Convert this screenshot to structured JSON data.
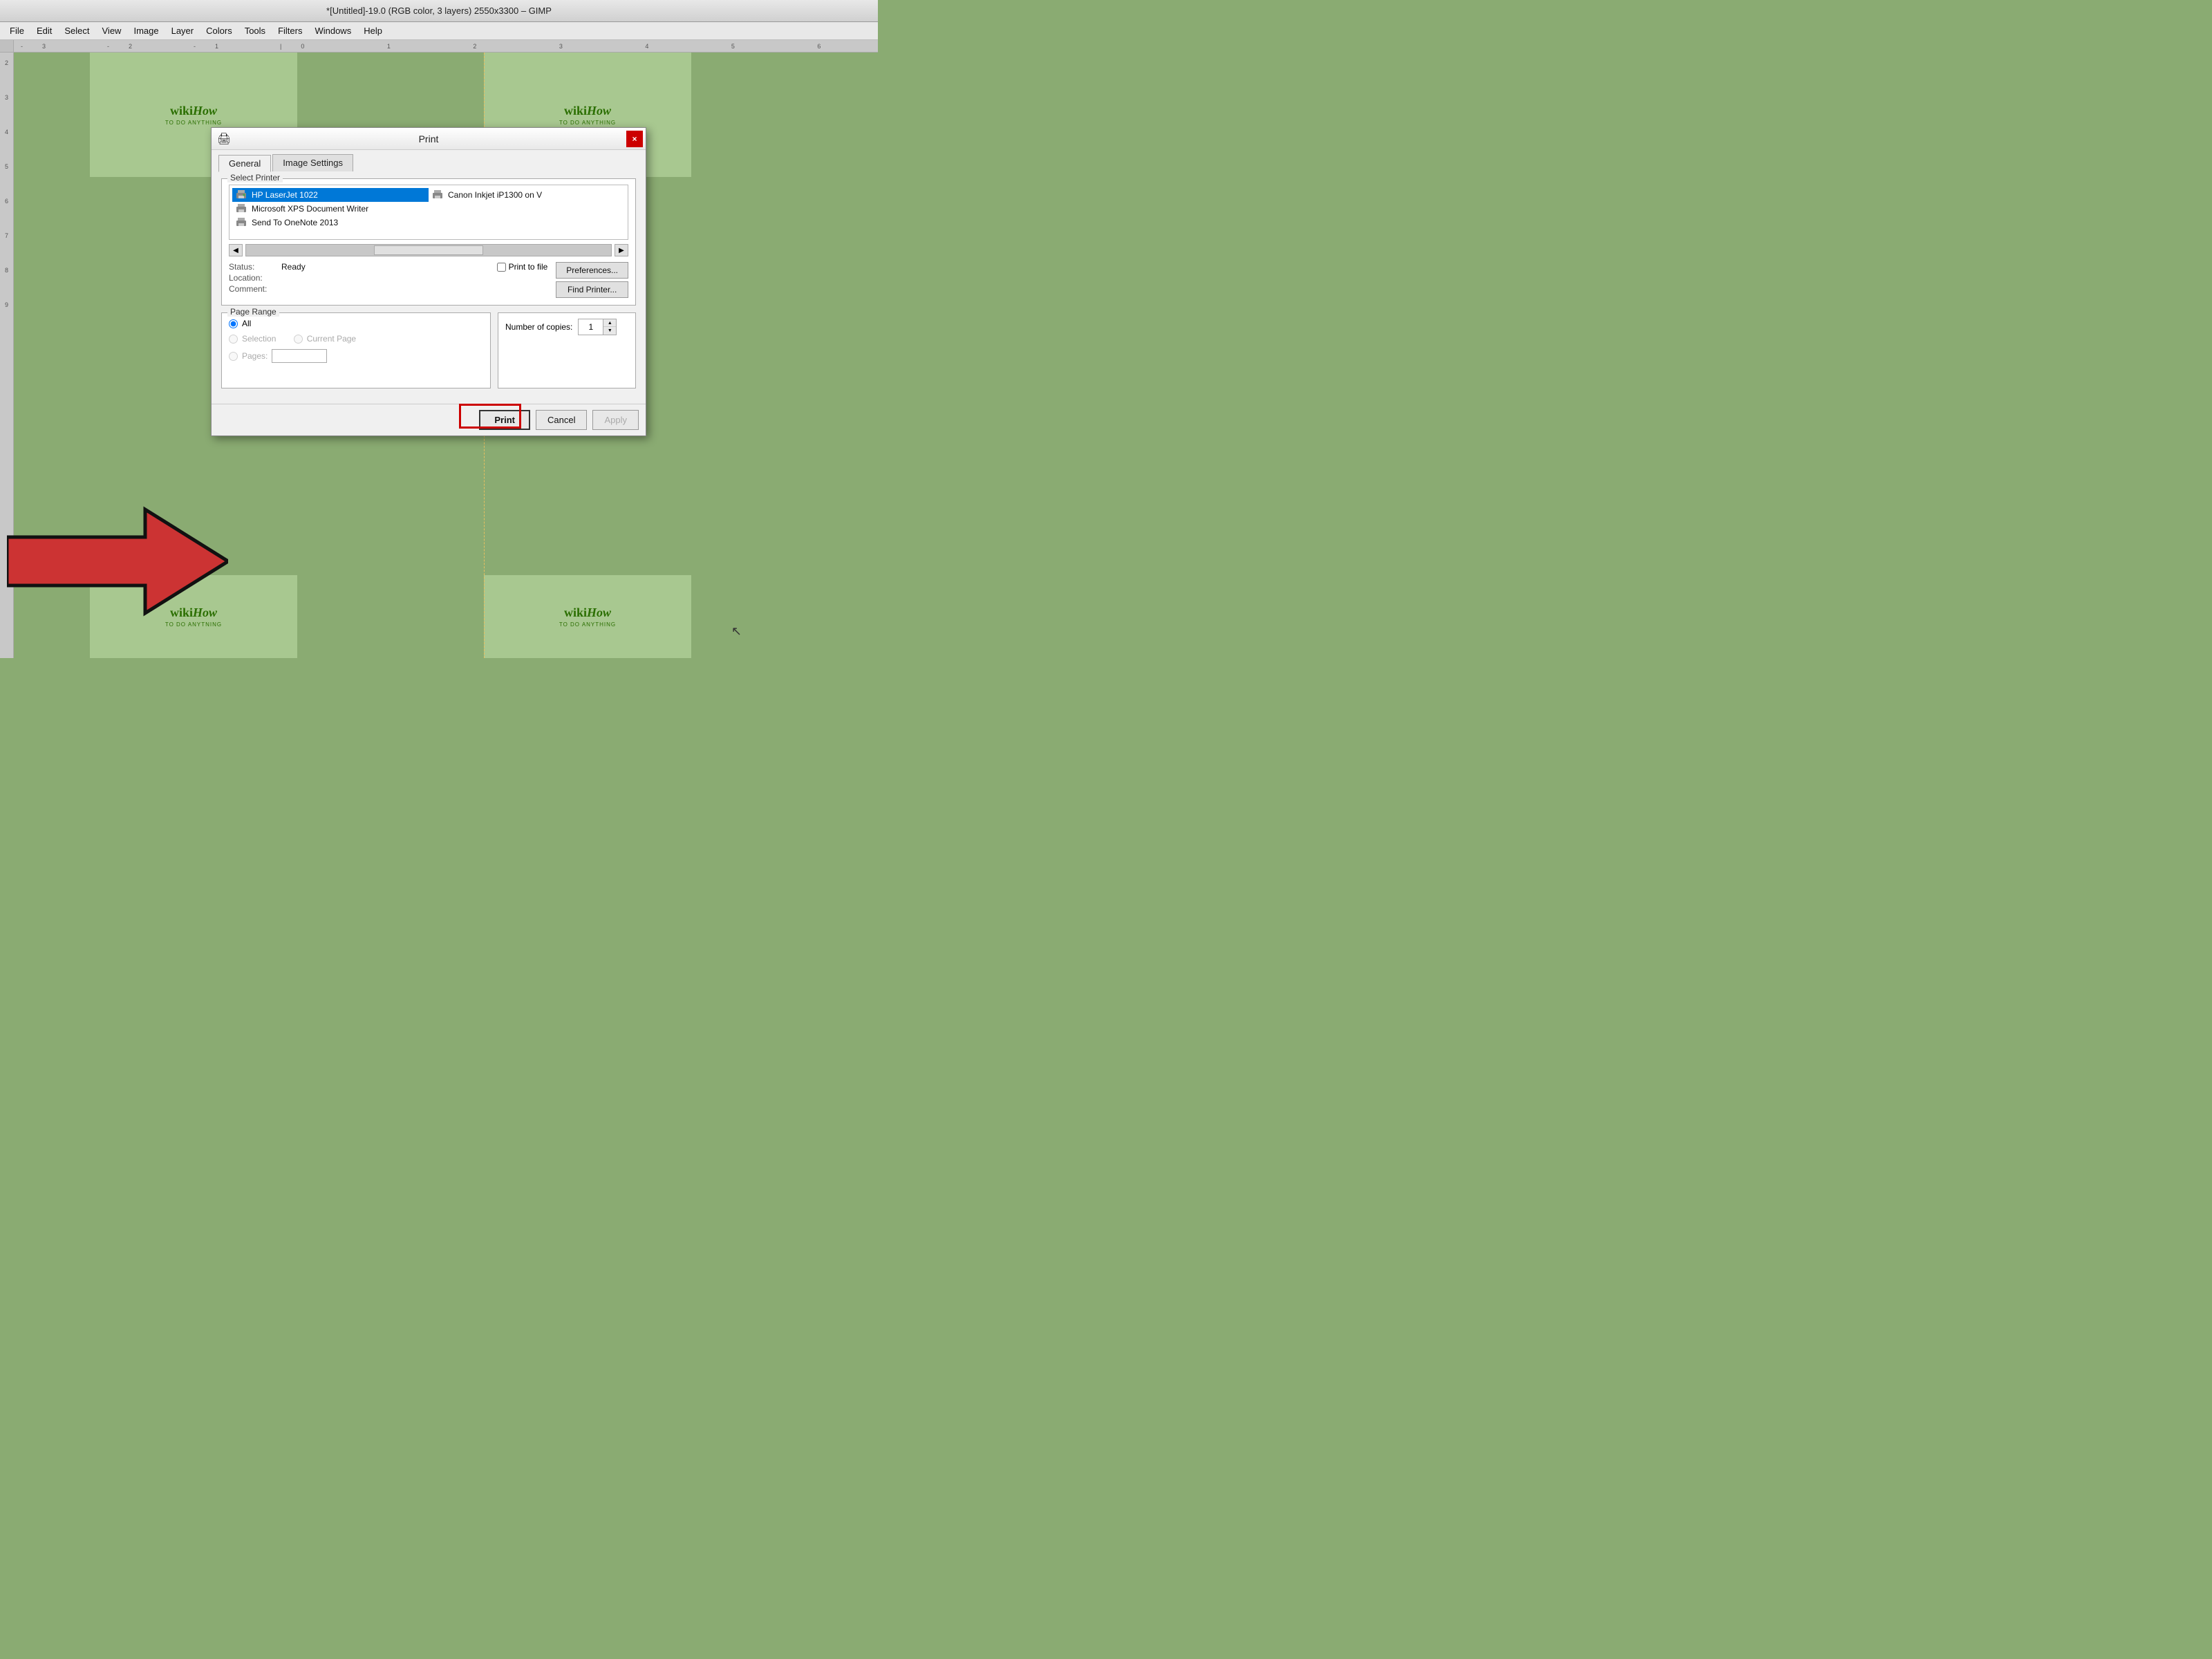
{
  "window": {
    "title": "*[Untitled]-19.0 (RGB color, 3 layers) 2550x3300 – GIMP",
    "menu_items": [
      "File",
      "Edit",
      "Select",
      "View",
      "Image",
      "Layer",
      "Colors",
      "Tools",
      "Filters",
      "Windows",
      "Help"
    ]
  },
  "dialog": {
    "title": "Print",
    "close_label": "×",
    "tabs": [
      "General",
      "Image Settings"
    ],
    "active_tab": "General",
    "select_printer_label": "Select Printer",
    "printers": [
      {
        "name": "HP LaserJet 1022",
        "col": 0
      },
      {
        "name": "Canon Inkjet iP1300 on V",
        "col": 1
      },
      {
        "name": "Microsoft XPS Document Writer",
        "col": 0
      },
      {
        "name": "Send To OneNote 2013",
        "col": 0
      }
    ],
    "status_label": "Status:",
    "status_value": "Ready",
    "location_label": "Location:",
    "location_value": "",
    "comment_label": "Comment:",
    "comment_value": "",
    "print_to_file_label": "Print to file",
    "preferences_label": "Preferences...",
    "find_printer_label": "Find Printer...",
    "page_range_label": "Page Range",
    "radio_all": "All",
    "radio_selection": "Selection",
    "radio_current_page": "Current Page",
    "radio_pages": "Pages:",
    "copies_label": "Number of copies:",
    "copies_value": "1",
    "print_button": "Print",
    "cancel_button": "Cancel",
    "apply_button": "Apply"
  },
  "wikihow": {
    "logo_wiki": "wiki",
    "logo_how": "How",
    "tagline": "TO DO ANYTHING"
  },
  "colors": {
    "background": "#8aab72",
    "dialog_bg": "#f0f0f0",
    "accent_red": "#cc0000",
    "ruler_bg": "#c8c8c8"
  }
}
